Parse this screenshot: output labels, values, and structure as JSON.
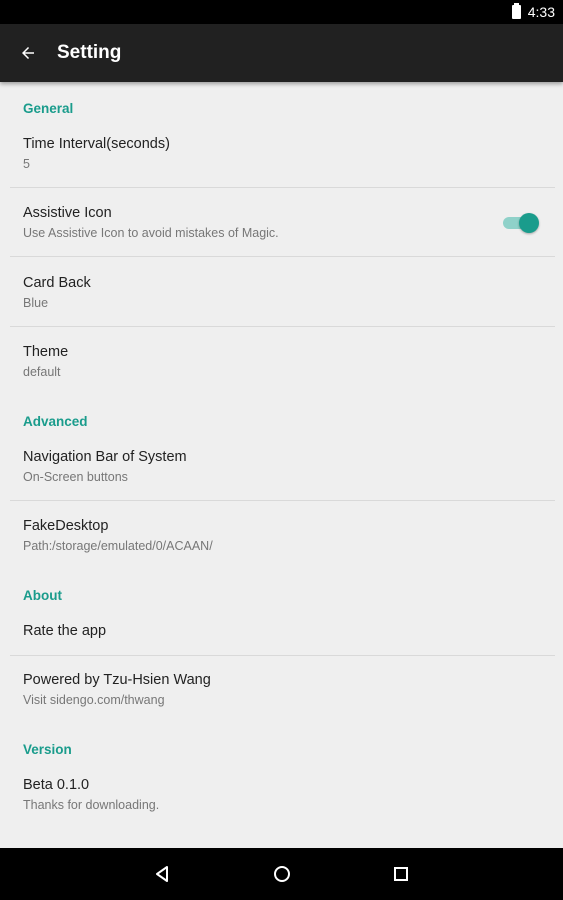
{
  "status_bar": {
    "time": "4:33"
  },
  "app_bar": {
    "title": "Setting"
  },
  "sections": {
    "general": "General",
    "advanced": "Advanced",
    "about": "About",
    "version": "Version"
  },
  "prefs": {
    "time_interval": {
      "title": "Time Interval(seconds)",
      "summary": "5"
    },
    "assistive_icon": {
      "title": "Assistive Icon",
      "summary": "Use Assistive Icon to avoid mistakes of Magic.",
      "enabled": true
    },
    "card_back": {
      "title": "Card Back",
      "summary": "Blue"
    },
    "theme": {
      "title": "Theme",
      "summary": "default"
    },
    "nav_bar": {
      "title": "Navigation Bar of System",
      "summary": "On-Screen buttons"
    },
    "fake_desktop": {
      "title": "FakeDesktop",
      "summary": "Path:/storage/emulated/0/ACAAN/"
    },
    "rate": {
      "title": "Rate the app"
    },
    "powered_by": {
      "title": "Powered by Tzu-Hsien Wang",
      "summary": "Visit sidengo.com/thwang"
    },
    "beta": {
      "title": "Beta 0.1.0",
      "summary": "Thanks for downloading."
    }
  },
  "colors": {
    "accent": "#1a9c8c",
    "app_bar": "#212121",
    "background": "#efefef"
  },
  "icons": {
    "back": "arrow-back-icon",
    "nav_back": "triangle-back-icon",
    "nav_home": "circle-home-icon",
    "nav_recents": "square-recents-icon"
  }
}
